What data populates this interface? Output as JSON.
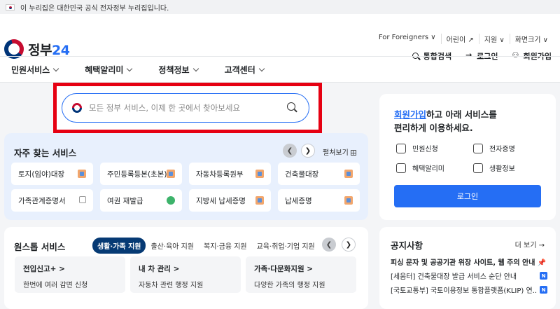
{
  "gov_banner": {
    "text": "이 누리집은 대한민국 공식 전자정부 누리집입니다."
  },
  "logo": {
    "text": "정부",
    "num": "24"
  },
  "utility": {
    "links": [
      "For Foreigners ∨",
      "어린이 ↗",
      "지원 ∨",
      "화면크기 ∨"
    ],
    "search": "통합검색",
    "login": "로그인",
    "signup": "회원가입"
  },
  "nav": {
    "items": [
      "민원서비스",
      "혜택알리미",
      "정책정보",
      "고객센터"
    ]
  },
  "search": {
    "placeholder": "모든 정부 서비스, 이제 한 곳에서 찾아보세요"
  },
  "frequent": {
    "title": "자주 찾는 서비스",
    "expand": "펼쳐보기",
    "items": [
      "토지(임야)대장",
      "주민등록등본(초본)",
      "자동차등록원부",
      "건축물대장",
      "가족관계증명서",
      "여권 재발급",
      "지방세 납세증명",
      "납세증명"
    ]
  },
  "onestop": {
    "title": "원스톱 서비스",
    "tabs": [
      "생활·가족 지원",
      "출산·육아 지원",
      "복지·금융 지원",
      "교육·취업·기업 지원"
    ],
    "cards": [
      {
        "title": "전입신고+ >",
        "desc": "한번에 여러 감면 신청"
      },
      {
        "title": "내 차 관리 >",
        "desc": "자동차 관련 행정 지원"
      },
      {
        "title": "가족·다문화지원 >",
        "desc": "다양한 가족의 행정 지원"
      }
    ]
  },
  "side_login": {
    "link": "회원가입",
    "title_rest": "하고 아래 서비스를",
    "title_line2": "편리하게 이용하세요.",
    "items": [
      "민원신청",
      "전자증명",
      "혜택알리미",
      "생활정보"
    ],
    "button": "로그인"
  },
  "notice": {
    "title": "공지사항",
    "more": "더 보기 →",
    "items": [
      "피싱 문자 및 공공기관 위장 사이트, 웹 주의 안내 📌",
      "[세움터] 건축물대장 발급 서비스 순단 안내",
      "[국토교통부] 국토이용정보 통합플랫폼(KLIP) 연..."
    ],
    "badge": "N"
  },
  "colors": {
    "primary": "#256ef4",
    "navy": "#063a74",
    "highlight": "#e60012"
  }
}
